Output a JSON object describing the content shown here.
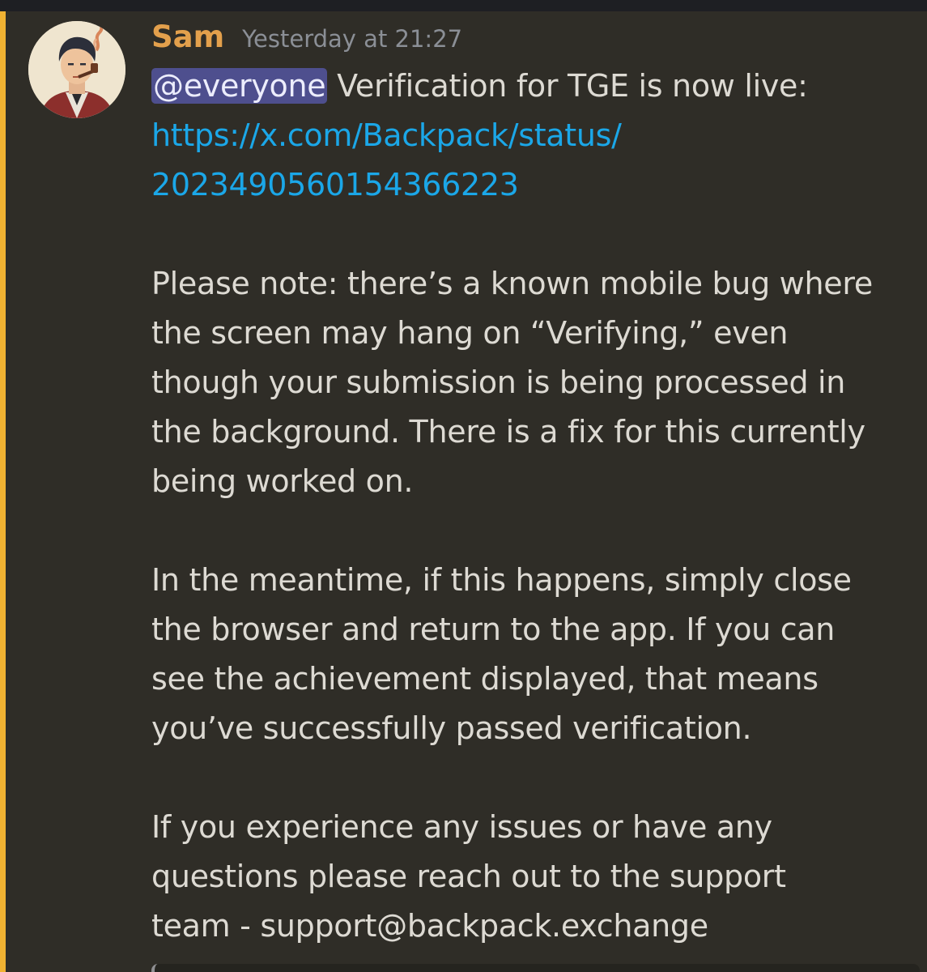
{
  "message": {
    "author": "Sam",
    "timestamp": "Yesterday at 21:27",
    "mention": "@everyone",
    "intro": "Verification for TGE is now live:",
    "link_line1": "https://x.com/Backpack/status/",
    "link_line2": "2023490560154366223",
    "paragraph1": [
      "Please note: there’s a known mobile bug where",
      "the screen may hang on “Verifying,” even",
      "though your submission is being processed in",
      "the background. There is a fix for this currently",
      "being worked on."
    ],
    "paragraph2": [
      "In the meantime, if this happens, simply close",
      "the browser and return to the app. If you can",
      "see the achievement displayed, that means",
      "you’ve successfully passed verification."
    ],
    "paragraph3": [
      "If you experience any issues or have any",
      "questions please reach out to the support",
      "team - support@backpack.exchange"
    ]
  },
  "colors": {
    "background": "#2f2d27",
    "username": "#e3a04c",
    "mention_highlight_bar": "#f0b232",
    "link": "#1ba7e8",
    "mention_pill": "#4e4f8e"
  },
  "icons": {
    "avatar": "illustrated-man-with-pipe-avatar"
  }
}
